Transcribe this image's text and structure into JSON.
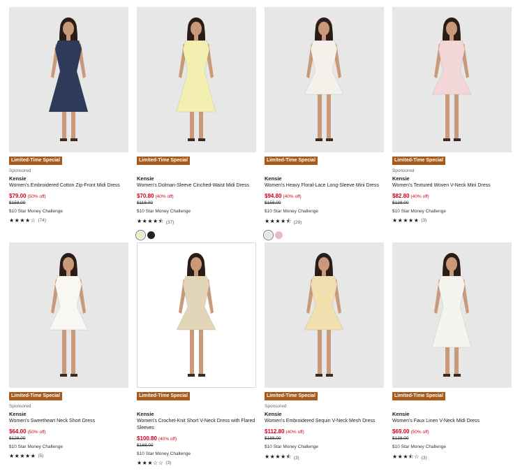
{
  "colors": {
    "price": "#d1001f",
    "badge": "#a85a1a"
  },
  "products": [
    {
      "badge": "Limited-Time Special",
      "sponsored": "Sponsored",
      "brand": "Kensie",
      "name": "Women's Embroidered Cotton Zip-Front Midi Dress",
      "price": "$79.00",
      "off": "(50% off)",
      "orig": "$158.00",
      "promo": "$10 Star Money Challenge",
      "stars": "★★★★☆",
      "count": "(74)",
      "dress": "#2e3b5a"
    },
    {
      "badge": "Limited-Time Special",
      "sponsored": "",
      "brand": "Kensie",
      "name": "Women's Dolman-Sleeve Cinched-Waist Midi Dress",
      "price": "$70.80",
      "off": "(40% off)",
      "orig": "$118.00",
      "promo": "$10 Star Money Challenge",
      "stars": "★★★★⯪",
      "count": "(37)",
      "dress": "#f2efb0",
      "swatches": [
        "#efeac8",
        "#2a1f22"
      ]
    },
    {
      "badge": "Limited-Time Special",
      "sponsored": "",
      "brand": "Kensie",
      "name": "Women's Heavy Floral-Lace Long-Sleeve Mini Dress",
      "price": "$94.80",
      "off": "(40% off)",
      "orig": "$158.00",
      "promo": "$10 Star Money Challenge",
      "stars": "★★★★⯪",
      "count": "(29)",
      "dress": "#f3f1ea",
      "swatches": [
        "#e9e6dc",
        "#e4b9cf"
      ]
    },
    {
      "badge": "Limited-Time Special",
      "sponsored": "Sponsored",
      "brand": "Kensie",
      "name": "Women's Textured Woven V-Neck Mini Dress",
      "price": "$82.80",
      "off": "(40% off)",
      "orig": "$138.00",
      "promo": "$10 Star Money Challenge",
      "stars": "★★★★★",
      "count": "(3)",
      "dress": "#f2d6d8"
    },
    {
      "badge": "Limited-Time Special",
      "sponsored": "Sponsored",
      "brand": "Kensie",
      "name": "Women's Sweetheart Neck Short Dress",
      "price": "$64.00",
      "off": "(50% off)",
      "orig": "$128.00",
      "promo": "$10 Star Money Challenge",
      "stars": "★★★★★",
      "count": "(5)",
      "dress": "#f8f7f2"
    },
    {
      "badge": "Limited-Time Special",
      "sponsored": "",
      "brand": "Kensie",
      "name": "Women's Crochet-Knit Short V-Neck Dress with Flared Sleeves",
      "price": "$100.80",
      "off": "(40% off)",
      "orig": "$168.00",
      "promo": "$10 Star Money Challenge",
      "stars": "★★★☆☆",
      "count": "(3)",
      "dress": "#e3d6b8"
    },
    {
      "badge": "Limited-Time Special",
      "sponsored": "Sponsored",
      "brand": "Kensie",
      "name": "Women's Embroidered Sequin V-Neck Mesh Dress",
      "price": "$112.80",
      "off": "(40% off)",
      "orig": "$188.00",
      "promo": "$10 Star Money Challenge",
      "stars": "★★★★⯪",
      "count": "(3)",
      "dress": "#f1dfb0"
    },
    {
      "badge": "Limited-Time Special",
      "sponsored": "",
      "brand": "Kensie",
      "name": "Women's Faux Linen V-Neck Midi Dress",
      "price": "$69.00",
      "off": "(50% off)",
      "orig": "$138.00",
      "promo": "$10 Star Money Challenge",
      "stars": "★★★⯪☆",
      "count": "(3)",
      "dress": "#f6f4ee"
    }
  ]
}
